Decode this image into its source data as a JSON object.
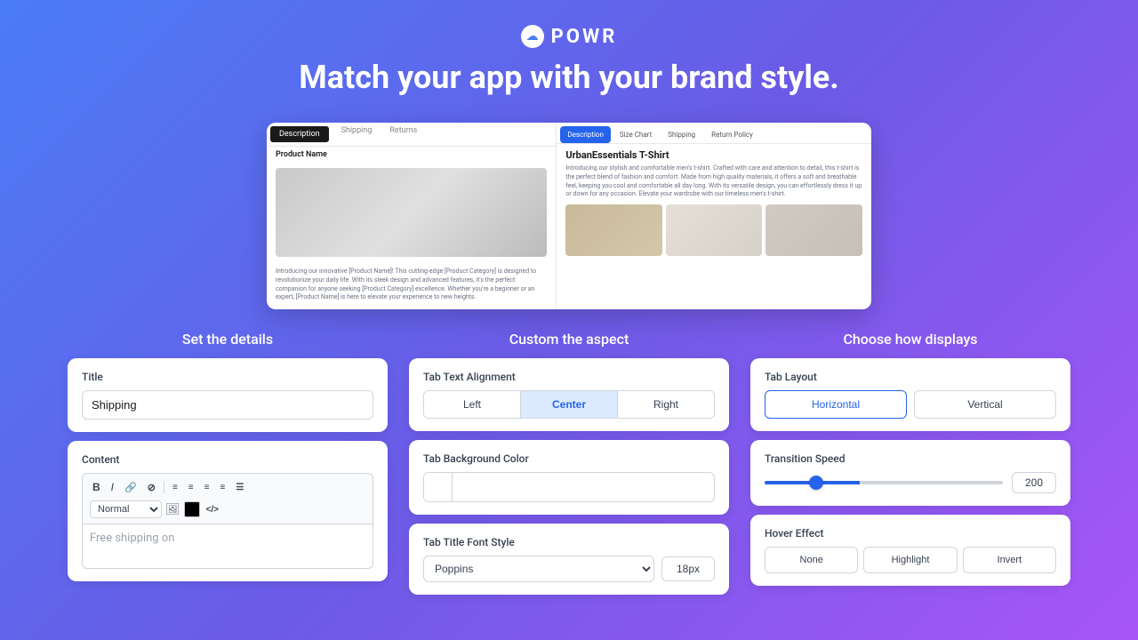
{
  "header": {
    "logo_text": "POWR",
    "headline": "Match your app with your brand style."
  },
  "preview": {
    "left_tabs": [
      "Description",
      "Shipping",
      "Returns"
    ],
    "left_active_tab": "Description",
    "product_name": "Product Name",
    "product_desc": "Introducing our innovative [Product Name]! This cutting-edge [Product Category] is designed to revolutionize your daily life. With its sleek design and advanced features, it's the perfect companion for anyone seeking [Product Category] excellence. Whether you're a beginner or an expert, [Product Name] is here to elevate your experience to new heights.",
    "right_tabs": [
      "Description",
      "Size Chart",
      "Shipping",
      "Return Policy"
    ],
    "right_active_tab": "Description",
    "product_title": "UrbanEssentials T-Shirt",
    "product_long_desc": "Introducing our stylish and comfortable men's t-shirt. Crafted with care and attention to detail, this t-shirt is the perfect blend of fashion and comfort. Made from high quality materials, it offers a soft and breathable feel, keeping you cool and comfortable all day long. With its versatile design, you can effortlessly dress it up or down for any occasion. Elevate your wardrobe with our timeless men's t-shirt."
  },
  "set_details": {
    "section_title": "Set the details",
    "title_label": "Title",
    "title_value": "Shipping",
    "content_label": "Content",
    "toolbar_bold": "B",
    "toolbar_italic": "I",
    "toolbar_link": "🔗",
    "toolbar_erase": "⊘",
    "toolbar_align_icons": [
      "≡",
      "≡",
      "≡",
      "≡",
      "≡"
    ],
    "font_style_select": "Normal",
    "editor_text": "Free shipping on"
  },
  "custom_aspect": {
    "section_title": "Custom the aspect",
    "alignment_label": "Tab Text Alignment",
    "alignment_options": [
      "Left",
      "Center",
      "Right"
    ],
    "alignment_active": "Center",
    "color_label": "Tab Background Color",
    "color_value": "",
    "font_label": "Tab Title Font Style",
    "font_select": "Poppins",
    "font_size": "18px"
  },
  "how_displays": {
    "section_title": "Choose how displays",
    "layout_label": "Tab Layout",
    "layout_options": [
      "Horizontal",
      "Vertical"
    ],
    "layout_active": "Horizontal",
    "speed_label": "Transition Speed",
    "speed_value": "200",
    "hover_label": "Hover Effect",
    "hover_options": [
      "None",
      "Highlight",
      "Invert"
    ]
  }
}
